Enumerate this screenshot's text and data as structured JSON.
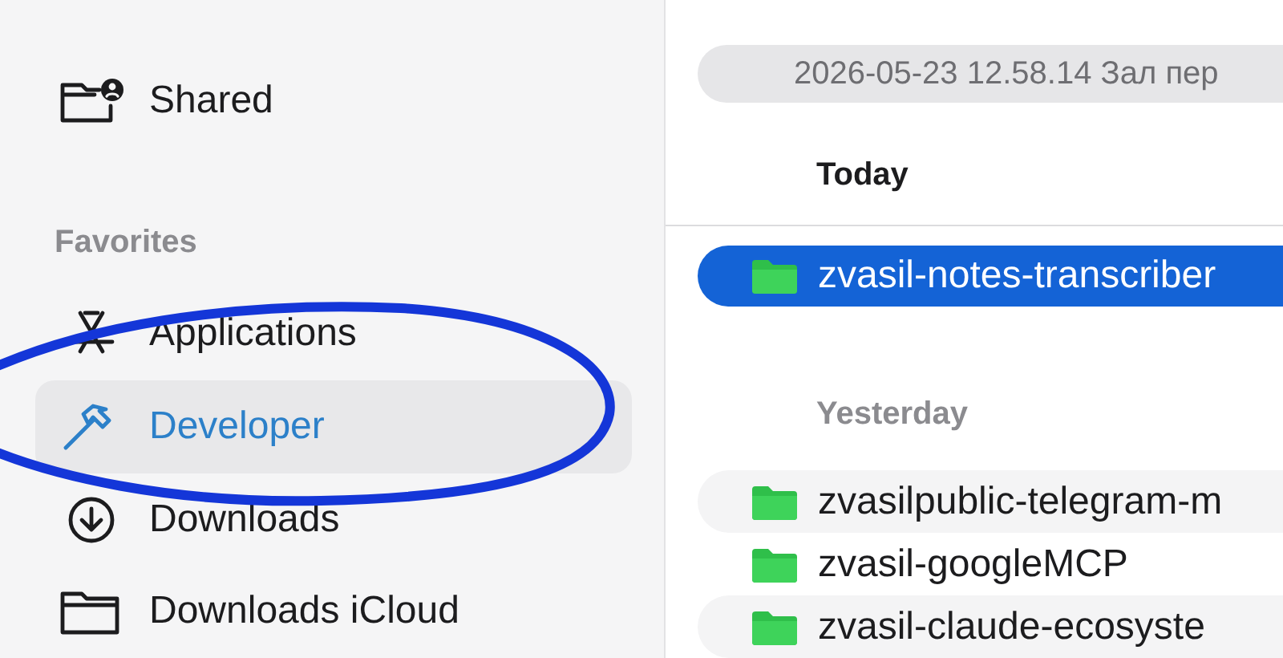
{
  "sidebar": {
    "items": [
      {
        "kind": "shared",
        "label": "Shared",
        "selected": false
      },
      {
        "kind": "heading",
        "label": "Favorites"
      },
      {
        "kind": "applications",
        "label": "Applications",
        "selected": false
      },
      {
        "kind": "developer",
        "label": "Developer",
        "selected": true
      },
      {
        "kind": "downloads",
        "label": "Downloads",
        "selected": false
      },
      {
        "kind": "folder",
        "label": "Downloads iCloud",
        "selected": false
      }
    ]
  },
  "path_bar": {
    "text": "2026-05-23 12.58.14 Зал пер"
  },
  "file_list": {
    "sections": [
      {
        "title": "Today",
        "items": [
          {
            "name": "zvasil-notes-transcriber",
            "selected": true
          }
        ]
      },
      {
        "title": "Yesterday",
        "items": [
          {
            "name": "zvasilpublic-telegram-m",
            "selected": false
          },
          {
            "name": "zvasil-googleMCP",
            "selected": false
          },
          {
            "name": "zvasil-claude-ecosyste",
            "selected": false
          }
        ]
      }
    ]
  }
}
